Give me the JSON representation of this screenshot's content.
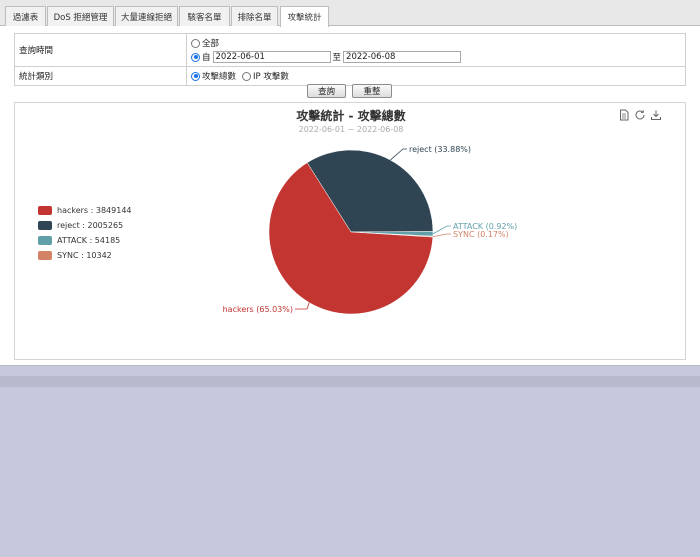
{
  "tabs": [
    {
      "label": "過濾表",
      "active": false
    },
    {
      "label": "DoS 拒絕管理",
      "active": false
    },
    {
      "label": "大量連線拒絕",
      "active": false
    },
    {
      "label": "駭客名單",
      "active": false
    },
    {
      "label": "排除名單",
      "active": false
    },
    {
      "label": "攻擊統計",
      "active": true
    }
  ],
  "form": {
    "time_label": "查詢時間",
    "all_option": "全部",
    "from_prefix": "自",
    "from_date": "2022-06-01",
    "to_prefix": "至",
    "to_date": "2022-06-08",
    "category_label": "統計類別",
    "category_option_total": "攻擊總數",
    "category_option_ip": "IP 攻擊數",
    "query_button": "查詢",
    "reset_button": "重整"
  },
  "colors": {
    "hackers": "#c23531",
    "reject": "#2f4554",
    "ATTACK": "#61a0a8",
    "SYNC": "#d48265"
  },
  "chart_data": {
    "type": "pie",
    "title": "攻擊統計 - 攻擊總數",
    "subtitle": "2022-06-01 ~ 2022-06-08",
    "legend_position": "left",
    "series": [
      {
        "name": "hackers",
        "value": 3849144,
        "percent_label": "hackers (65.03%)",
        "legend_label": "hackers : 3849144"
      },
      {
        "name": "reject",
        "value": 2005265,
        "percent_label": "reject (33.88%)",
        "legend_label": "reject : 2005265"
      },
      {
        "name": "ATTACK",
        "value": 54185,
        "percent_label": "ATTACK (0.92%)",
        "legend_label": "ATTACK : 54185"
      },
      {
        "name": "SYNC",
        "value": 10342,
        "percent_label": "SYNC (0.17%)",
        "legend_label": "SYNC : 10342"
      }
    ],
    "toolbox": [
      "data-view-icon",
      "restore-icon",
      "save-image-icon"
    ]
  }
}
